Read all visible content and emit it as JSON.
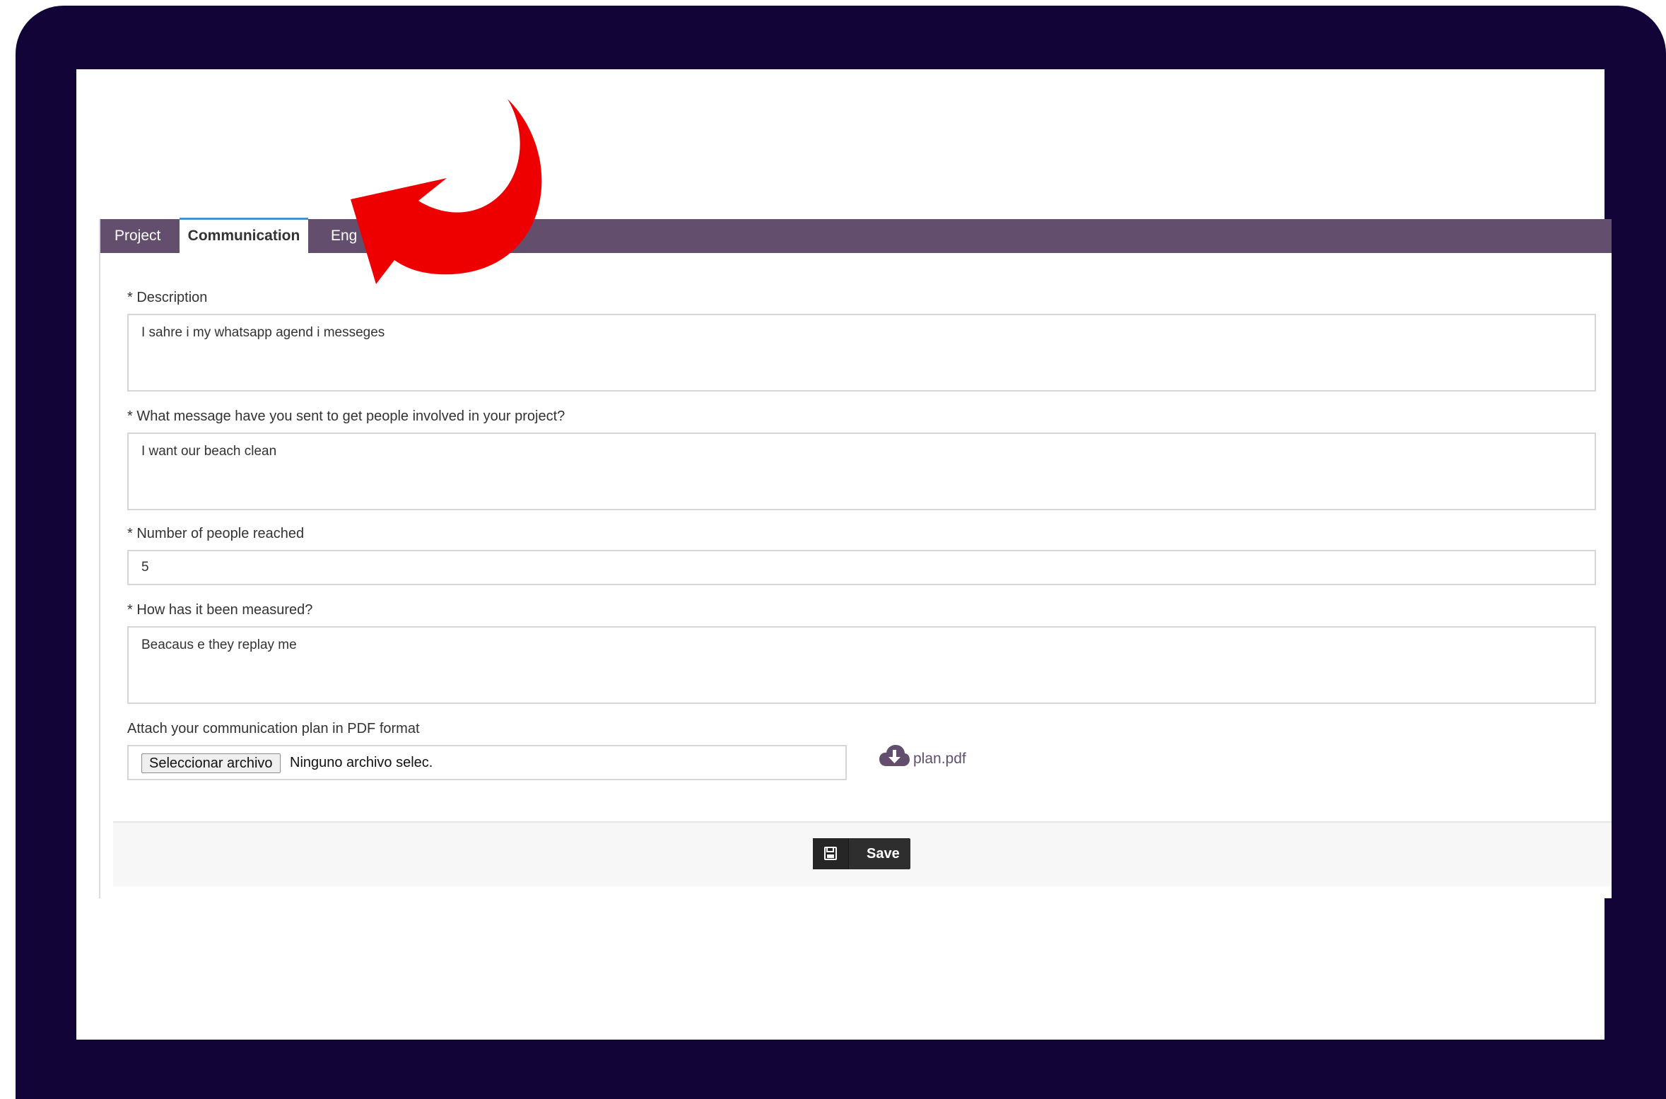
{
  "tabs": [
    {
      "label": "Project",
      "active": false
    },
    {
      "label": "Communication",
      "active": true
    },
    {
      "label": "Eng",
      "active": false
    }
  ],
  "form": {
    "description": {
      "label": "* Description",
      "value": "I sahre i my whatsapp agend i messeges"
    },
    "message": {
      "label": "* What message have you sent to get people involved in your project?",
      "value": "I want our beach clean"
    },
    "people": {
      "label": "* Number of people reached",
      "value": "5"
    },
    "measured": {
      "label": "* How has it been measured?",
      "value": "Beacaus e they replay me"
    },
    "attachment": {
      "label": "Attach your communication plan in PDF format",
      "button": "Seleccionar archivo",
      "status": "Ninguno archivo selec.",
      "file_name": "plan.pdf",
      "file_icon": "cloud-download-icon"
    }
  },
  "footer": {
    "save_label": "Save",
    "save_icon": "floppy-disk-icon"
  },
  "colors": {
    "frame": "#120436",
    "tabbar": "#634e6d",
    "active_tab_accent": "#4a90c8",
    "annotation_arrow": "#ee0000",
    "save_button": "#2e2e2e"
  }
}
